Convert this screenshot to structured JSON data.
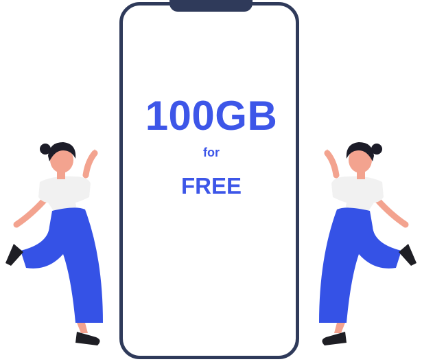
{
  "promo": {
    "amount": "100GB",
    "connector": "for",
    "offer": "FREE"
  },
  "colors": {
    "accent": "#3d56e8",
    "frame": "#2f3a5a",
    "skin": "#f3a38f",
    "hair": "#1c1c28",
    "shirt": "#f1f1f1",
    "pants": "#3552e6",
    "shoe": "#1e1e24"
  },
  "illustrations": {
    "left": "dancing-woman-illustration",
    "right": "dancing-woman-illustration-mirrored"
  }
}
